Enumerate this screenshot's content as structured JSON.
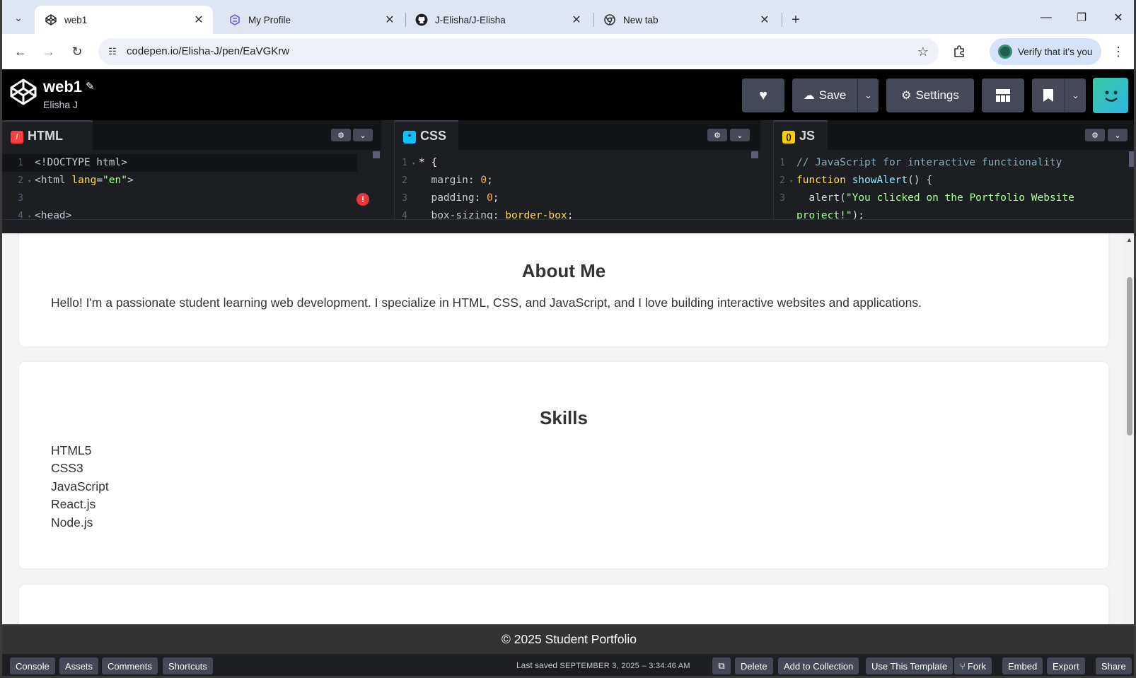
{
  "browser": {
    "tabs": [
      {
        "title": "web1",
        "icon": "codepen-icon",
        "active": true
      },
      {
        "title": "My Profile",
        "icon": "profile-icon",
        "active": false
      },
      {
        "title": "J-Elisha/J-Elisha",
        "icon": "github-icon",
        "active": false
      },
      {
        "title": "New tab",
        "icon": "chrome-icon",
        "active": false
      }
    ],
    "url": "codepen.io/Elisha-J/pen/EaVGKrw",
    "verify_label": "Verify that it's you"
  },
  "pen": {
    "title": "web1",
    "author": "Elisha J",
    "buttons": {
      "save": "Save",
      "settings": "Settings"
    }
  },
  "editors": {
    "html": {
      "label": "HTML",
      "lines": [
        {
          "n": "1",
          "text": "<!DOCTYPE html>"
        },
        {
          "n": "2",
          "tag_open": "<html ",
          "attr": "lang",
          "eq": "=",
          "str": "\"en\"",
          "tag_close": ">"
        },
        {
          "n": "3",
          "text": ""
        },
        {
          "n": "4",
          "text": "<head>"
        }
      ]
    },
    "css": {
      "label": "CSS",
      "lines": [
        {
          "n": "1",
          "sel": "* {"
        },
        {
          "n": "2",
          "prop": "margin",
          "num": "0"
        },
        {
          "n": "3",
          "prop": "padding",
          "num": "0"
        },
        {
          "n": "4",
          "prop": "box-sizing",
          "val": "border-box"
        }
      ]
    },
    "js": {
      "label": "JS",
      "lines": [
        {
          "n": "1",
          "comment": "// JavaScript for interactive functionality"
        },
        {
          "n": "2",
          "kw": "function",
          "fn": "showAlert",
          "rest": "() {"
        },
        {
          "n": "3",
          "call": "alert(",
          "str": "\"You clicked on the Portfolio Website"
        },
        {
          "n": "",
          "str": "project!\"",
          "rest": ");"
        }
      ]
    }
  },
  "preview": {
    "about": {
      "heading": "About Me",
      "text": "Hello! I'm a passionate student learning web development. I specialize in HTML, CSS, and JavaScript, and I love building interactive websites and applications."
    },
    "skills": {
      "heading": "Skills",
      "items": [
        "HTML5",
        "CSS3",
        "JavaScript",
        "React.js",
        "Node.js"
      ]
    },
    "footer": "© 2025 Student Portfolio"
  },
  "bottombar": {
    "left": [
      "Console",
      "Assets",
      "Comments",
      "Shortcuts"
    ],
    "saved_prefix": "Last saved",
    "saved_date": "SEPTEMBER 3, 2025 – 3:34:46 AM",
    "right": [
      "Delete",
      "Add to Collection",
      "Use This Template",
      "Fork",
      "Embed",
      "Export",
      "Share"
    ]
  },
  "colors": {
    "html_icon": "#ff3c41",
    "css_icon": "#0ebeff",
    "js_icon": "#fcd000",
    "codepen_bg": "#000000",
    "button_bg": "#444857"
  }
}
